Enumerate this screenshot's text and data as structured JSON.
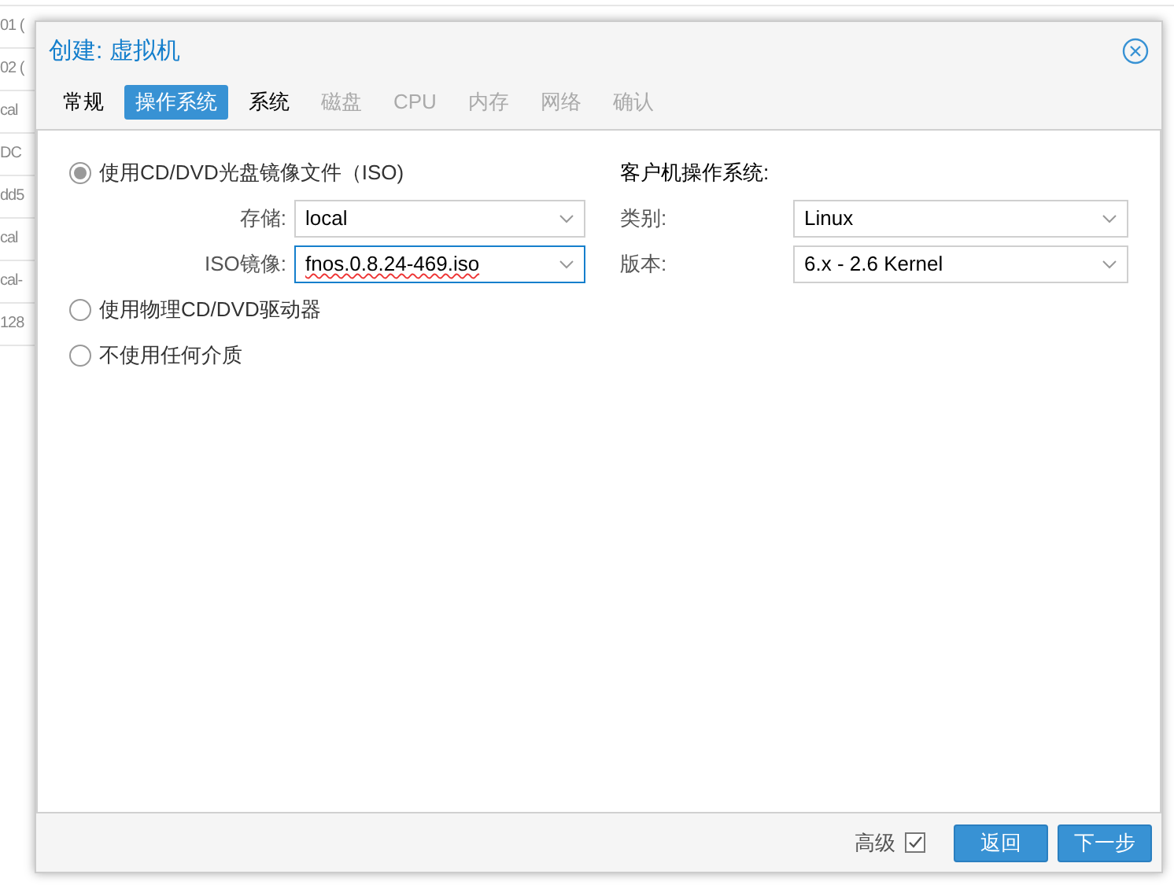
{
  "background_list": [
    "01 (",
    "02 (",
    "cal",
    "DC",
    "dd5",
    "cal",
    "cal-",
    "128"
  ],
  "dialog": {
    "title": "创建: 虚拟机",
    "tabs": [
      {
        "label": "常规",
        "selected": false,
        "disabled": false
      },
      {
        "label": "操作系统",
        "selected": true,
        "disabled": false
      },
      {
        "label": "系统",
        "selected": false,
        "disabled": false
      },
      {
        "label": "磁盘",
        "selected": false,
        "disabled": true
      },
      {
        "label": "CPU",
        "selected": false,
        "disabled": true
      },
      {
        "label": "内存",
        "selected": false,
        "disabled": true
      },
      {
        "label": "网络",
        "selected": false,
        "disabled": true
      },
      {
        "label": "确认",
        "selected": false,
        "disabled": true
      }
    ],
    "media_options": [
      {
        "label": "使用CD/DVD光盘镜像文件（ISO)",
        "selected": true,
        "fields": [
          {
            "label": "存储:",
            "value": "local"
          },
          {
            "label": "ISO镜像:",
            "value": "fnos.0.8.24-469.iso",
            "focused": true
          }
        ]
      },
      {
        "label": "使用物理CD/DVD驱动器",
        "selected": false
      },
      {
        "label": "不使用任何介质",
        "selected": false
      }
    ],
    "guest_os": {
      "heading": "客户机操作系统:",
      "fields": [
        {
          "label": "类别:",
          "value": "Linux"
        },
        {
          "label": "版本:",
          "value": "6.x - 2.6 Kernel"
        }
      ]
    },
    "footer": {
      "advanced": {
        "label": "高级",
        "checked": true
      },
      "buttons": [
        "返回",
        "下一步"
      ]
    }
  }
}
